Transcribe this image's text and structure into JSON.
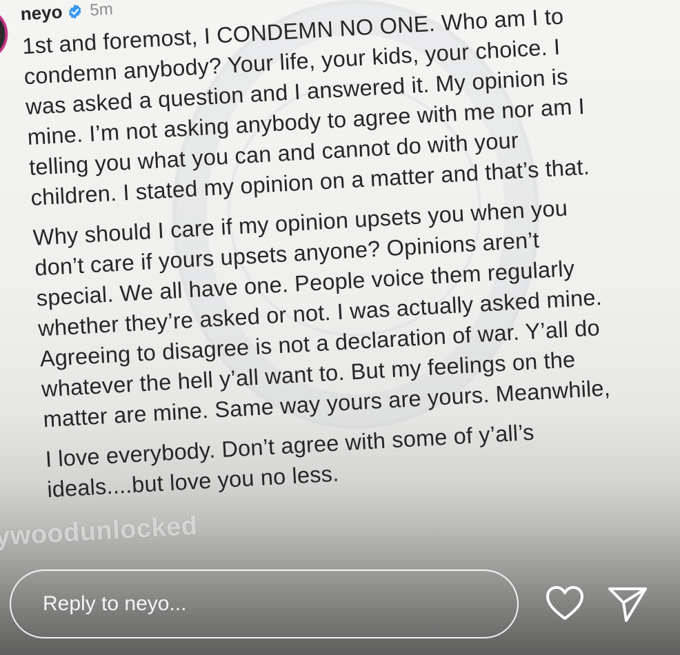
{
  "post": {
    "username": "neyo",
    "time": "5m",
    "paragraphs": [
      "1st and foremost, I CONDEMN NO ONE. Who am I to\ncondemn anybody? Your life, your kids, your choice. I\nwas asked a question and I answered it. My opinion is\nmine. I’m not asking anybody to agree with me nor am I\ntelling you what you can and cannot do with your\nchildren. I stated my opinion on a matter and that’s that.",
      "Why should I care if my opinion upsets you when you\ndon’t care if yours upsets anyone? Opinions aren’t\nspecial. We all have one. People voice them regularly\nwhether they’re asked or not. I was actually asked mine.\nAgreeing to disagree is not a declaration of war. Y’all do\nwhatever the hell y’all want to. But my feelings on the\nmatter are mine. Same way yours are yours. Meanwhile,",
      "I love everybody. Don’t agree with some of y’all’s\nideals....but love you no less."
    ]
  },
  "watermark": {
    "text": "ywoodunlocked"
  },
  "reply": {
    "placeholder": "Reply to neyo..."
  },
  "icons": {
    "verified": "verified-badge-icon",
    "like": "heart-icon",
    "share": "send-icon"
  },
  "colors": {
    "verified_blue": "#3897f0",
    "avatar_ring": "#c13584",
    "text": "#262626",
    "muted": "#8e8e8e"
  }
}
